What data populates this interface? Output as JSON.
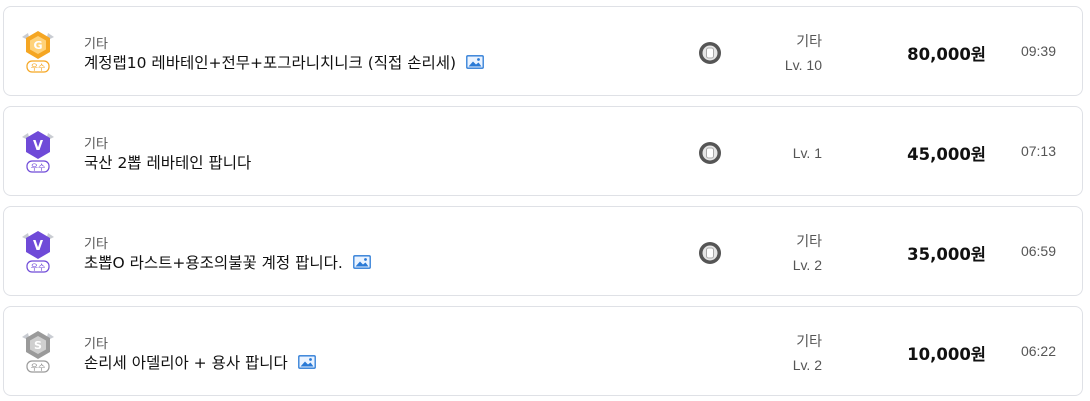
{
  "listings": [
    {
      "badge": {
        "letter": "G",
        "label": "우수",
        "color": "#f5a623",
        "icon": "gold-grade-badge-icon"
      },
      "category": "기타",
      "title": "계정랩10 레바테인+전무+포그라니치니크 (직접 손리세)",
      "has_image": true,
      "has_seller_icon": true,
      "meta_category": "기타",
      "level": "Lv. 10",
      "price": "80,000원",
      "time": "09:39"
    },
    {
      "badge": {
        "letter": "V",
        "label": "우수",
        "color": "#6f4ad8",
        "icon": "vip-grade-badge-icon"
      },
      "category": "기타",
      "title": "국산 2뽑 레바테인 팝니다",
      "has_image": false,
      "has_seller_icon": true,
      "meta_category": "",
      "level": "Lv. 1",
      "price": "45,000원",
      "time": "07:13"
    },
    {
      "badge": {
        "letter": "V",
        "label": "우수",
        "color": "#6f4ad8",
        "icon": "vip-grade-badge-icon"
      },
      "category": "기타",
      "title": "초뽑O 라스트+용조의불꽃 계정 팝니다.",
      "has_image": true,
      "has_seller_icon": true,
      "meta_category": "기타",
      "level": "Lv. 2",
      "price": "35,000원",
      "time": "06:59"
    },
    {
      "badge": {
        "letter": "S",
        "label": "우수",
        "color": "#9a9a9a",
        "icon": "silver-grade-badge-icon"
      },
      "category": "기타",
      "title": "손리세 아델리아 + 용사 팝니다",
      "has_image": true,
      "has_seller_icon": false,
      "meta_category": "기타",
      "level": "Lv. 2",
      "price": "10,000원",
      "time": "06:22"
    }
  ],
  "icons": {
    "image_attachment": "image-attachment-icon",
    "seller": "seller-status-icon"
  }
}
